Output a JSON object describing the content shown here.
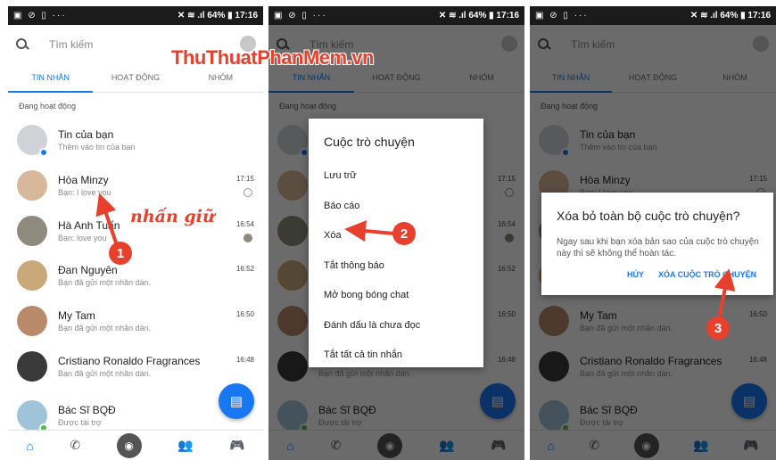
{
  "brand": {
    "watermark": "ThuThuatPhanMem.vn",
    "accent": "#1878f3",
    "annotation_color": "#e8402d"
  },
  "status_bar": {
    "left_icons": "▣ ⊘ ▯ ···",
    "right": "✕ ≋ .ıl 64% ▮ 17:16"
  },
  "search": {
    "placeholder": "Tìm kiếm"
  },
  "tabs": [
    "TIN NHẮN",
    "HOẠT ĐỘNG",
    "NHÓM"
  ],
  "section_label": "Đang hoạt động",
  "conversations": [
    {
      "name": "Tin của bạn",
      "subtitle": "Thêm vào tin của bạn",
      "time": "",
      "avatar_color": "#cfd3d8"
    },
    {
      "name": "Hòa Minzy",
      "subtitle": "Bạn: I love you",
      "time": "17:15",
      "avatar_color": "#d8b89a"
    },
    {
      "name": "Hà Anh Tuấn",
      "subtitle": "Bạn: love you",
      "time": "16:54",
      "avatar_color": "#8e8a7e"
    },
    {
      "name": "Đan Nguyên",
      "subtitle": "Bạn đã gửi một nhãn dán.",
      "time": "16:52",
      "avatar_color": "#c9a97a"
    },
    {
      "name": "My Tam",
      "subtitle": "Bạn đã gửi một nhãn dán.",
      "time": "16:50",
      "avatar_color": "#b88a6a"
    },
    {
      "name": "Cristiano Ronaldo Fragrances",
      "subtitle": "Bạn đã gửi một nhãn dán.",
      "time": "16:48",
      "avatar_color": "#3a3a3a"
    },
    {
      "name": "Bác Sĩ BQĐ",
      "subtitle": "Được tài trợ",
      "time": "",
      "avatar_color": "#9fc3d9"
    }
  ],
  "context_menu": {
    "title": "Cuộc trò chuyện",
    "items": [
      "Lưu trữ",
      "Báo cáo",
      "Xóa",
      "Tắt thông báo",
      "Mở bong bóng chat",
      "Đánh dấu là chưa đọc",
      "Tắt tất cả tin nhắn"
    ]
  },
  "dialog": {
    "title": "Xóa bỏ toàn bộ cuộc trò chuyện?",
    "body": "Ngay sau khi bạn xóa bản sao của cuộc trò chuyện này thì sẽ không thể hoàn tác.",
    "cancel": "HỦY",
    "confirm": "XÓA CUỘC TRÒ CHUYỆN"
  },
  "annotations": {
    "hold_text": "nhấn giữ",
    "step1": "1",
    "step2": "2",
    "step3": "3"
  },
  "icons": {
    "bottom_nav": [
      "home-icon",
      "phone-icon",
      "camera-icon",
      "people-icon",
      "game-icon"
    ],
    "fab": "compose-icon"
  }
}
